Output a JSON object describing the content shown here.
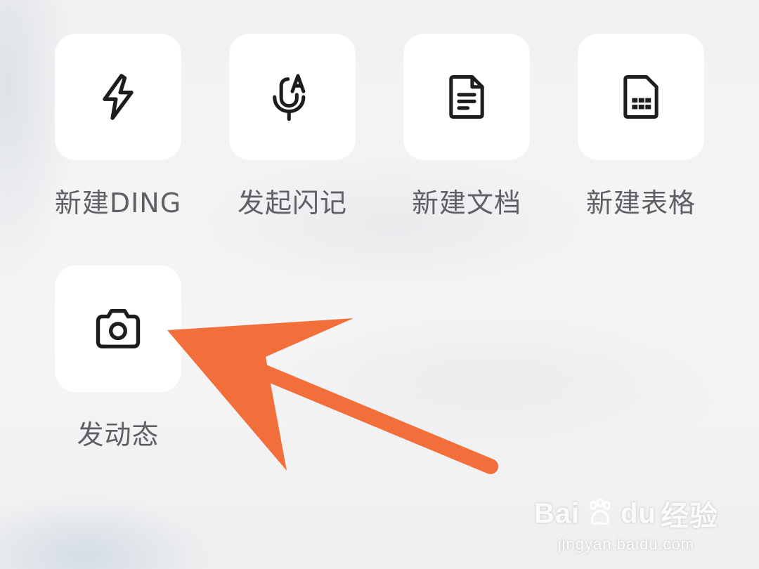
{
  "actions": [
    {
      "id": "ding",
      "label": "新建DING",
      "icon": "lightning-icon"
    },
    {
      "id": "flash",
      "label": "发起闪记",
      "icon": "microphone-a-icon"
    },
    {
      "id": "doc",
      "label": "新建文档",
      "icon": "document-icon"
    },
    {
      "id": "sheet",
      "label": "新建表格",
      "icon": "spreadsheet-icon"
    },
    {
      "id": "moment",
      "label": "发动态",
      "icon": "camera-icon"
    }
  ],
  "annotation": {
    "arrow_color": "#f26f3c",
    "points_to": "发动态"
  },
  "watermark": {
    "logo_text": "Bai",
    "logo_suffix": "du",
    "logo_cn": "经验",
    "url": "jingyan.baidu.com"
  },
  "colors": {
    "tile_bg": "#ffffff",
    "label": "#5e6066",
    "icon": "#1d1d1f"
  }
}
